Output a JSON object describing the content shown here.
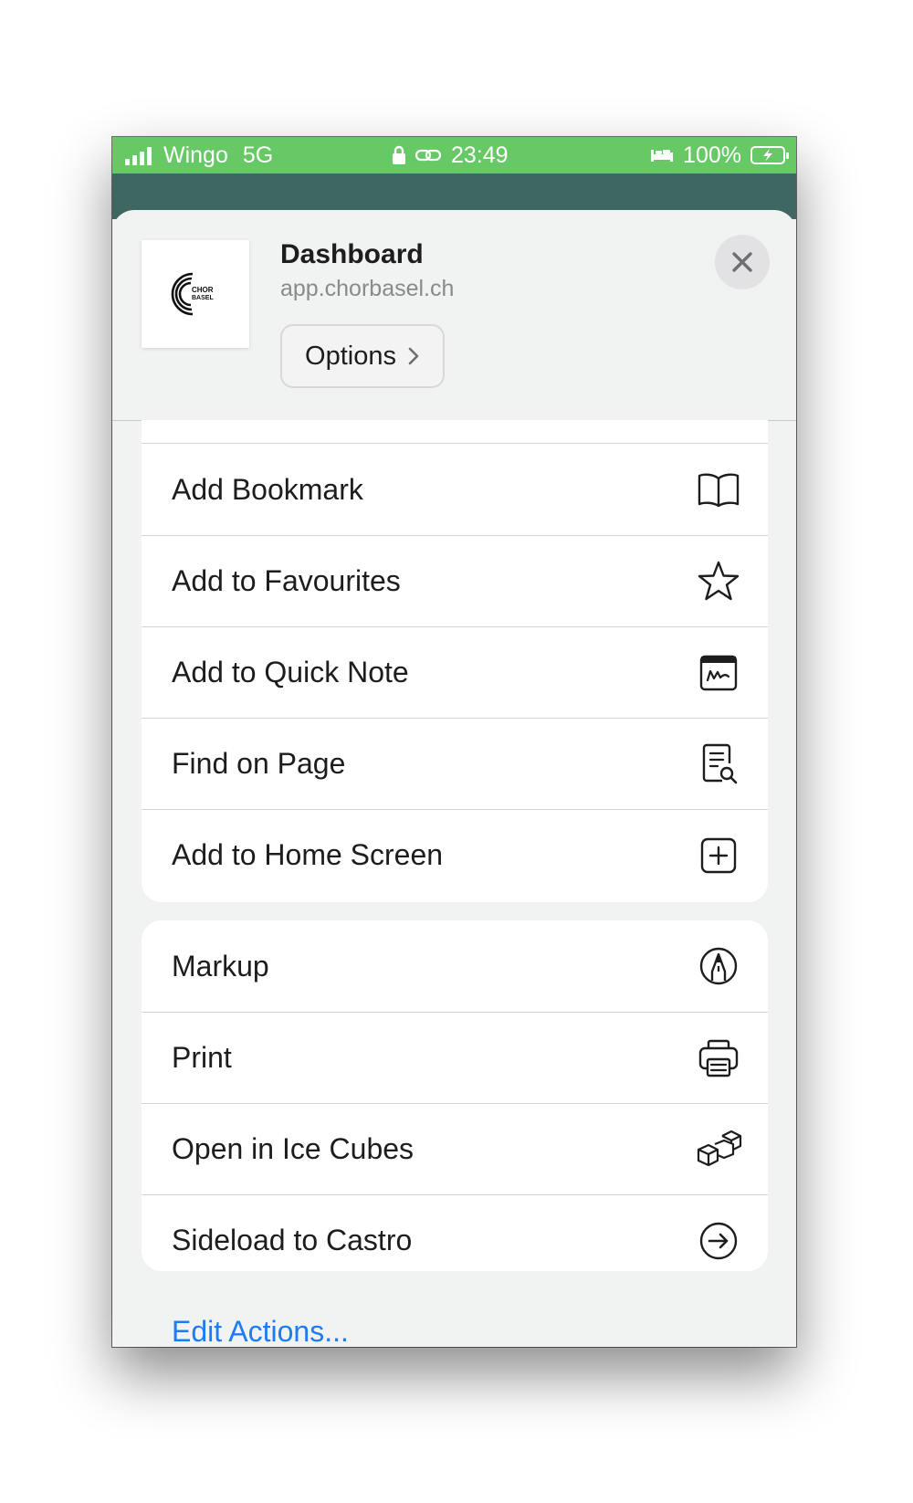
{
  "status_bar": {
    "carrier": "Wingo",
    "network": "5G",
    "time": "23:49",
    "battery": "100%"
  },
  "header": {
    "title": "Dashboard",
    "url": "app.chorbasel.ch",
    "options_label": "Options",
    "favicon_text_line1": "CHOR",
    "favicon_text_line2": "BASEL"
  },
  "group1": [
    {
      "label": "Add Bookmark",
      "icon": "book-icon"
    },
    {
      "label": "Add to Favourites",
      "icon": "star-icon"
    },
    {
      "label": "Add to Quick Note",
      "icon": "quick-note-icon"
    },
    {
      "label": "Find on Page",
      "icon": "find-doc-icon"
    },
    {
      "label": "Add to Home Screen",
      "icon": "plus-square-icon"
    }
  ],
  "group2": [
    {
      "label": "Markup",
      "icon": "markup-pen-icon"
    },
    {
      "label": "Print",
      "icon": "printer-icon"
    },
    {
      "label": "Open in Ice Cubes",
      "icon": "cubes-icon"
    },
    {
      "label": "Sideload to Castro",
      "icon": "arrow-circle-icon"
    }
  ],
  "edit_actions": "Edit Actions..."
}
